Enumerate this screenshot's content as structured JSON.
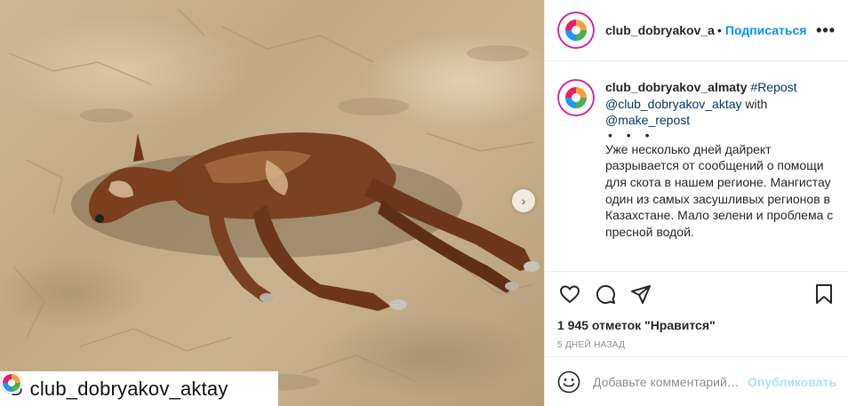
{
  "photo": {
    "repost_banner": {
      "arrows_icon": "repost-arrows-icon",
      "username": "club_dobryakov_aktay"
    },
    "next_icon": "chevron-right-icon",
    "next_glyph": "›"
  },
  "header": {
    "username": "club_dobryakov_almaty",
    "dot": "•",
    "follow_label": "Подписаться",
    "more_glyph": "•••"
  },
  "caption": {
    "username": "club_dobryakov_almaty",
    "hashtag": "#Repost",
    "mention1": "@club_dobryakov_aktay",
    "with": "with",
    "mention2": "@make_repost",
    "separator": "• • •",
    "body": "Уже несколько дней дайрект разрывается от сообщений о помощи для скота в нашем регионе. Мангистау один из самых засушливых регионов в Казахстане. Мало зелени и проблема с пресной водой."
  },
  "actions": {
    "like_icon": "heart-icon",
    "comment_icon": "comment-icon",
    "share_icon": "share-icon",
    "save_icon": "bookmark-icon",
    "likes": "1 945 отметок \"Нравится\"",
    "time_ago": "5 ДНЕЙ НАЗАД"
  },
  "comment": {
    "emoji_icon": "smiley-icon",
    "placeholder": "Добавьте комментарий…",
    "publish_label": "Опубликовать"
  },
  "colors": {
    "accent": "#0095f6",
    "publish_disabled": "#b2dffc",
    "link": "#00376b",
    "muted": "#8e8e8e"
  }
}
